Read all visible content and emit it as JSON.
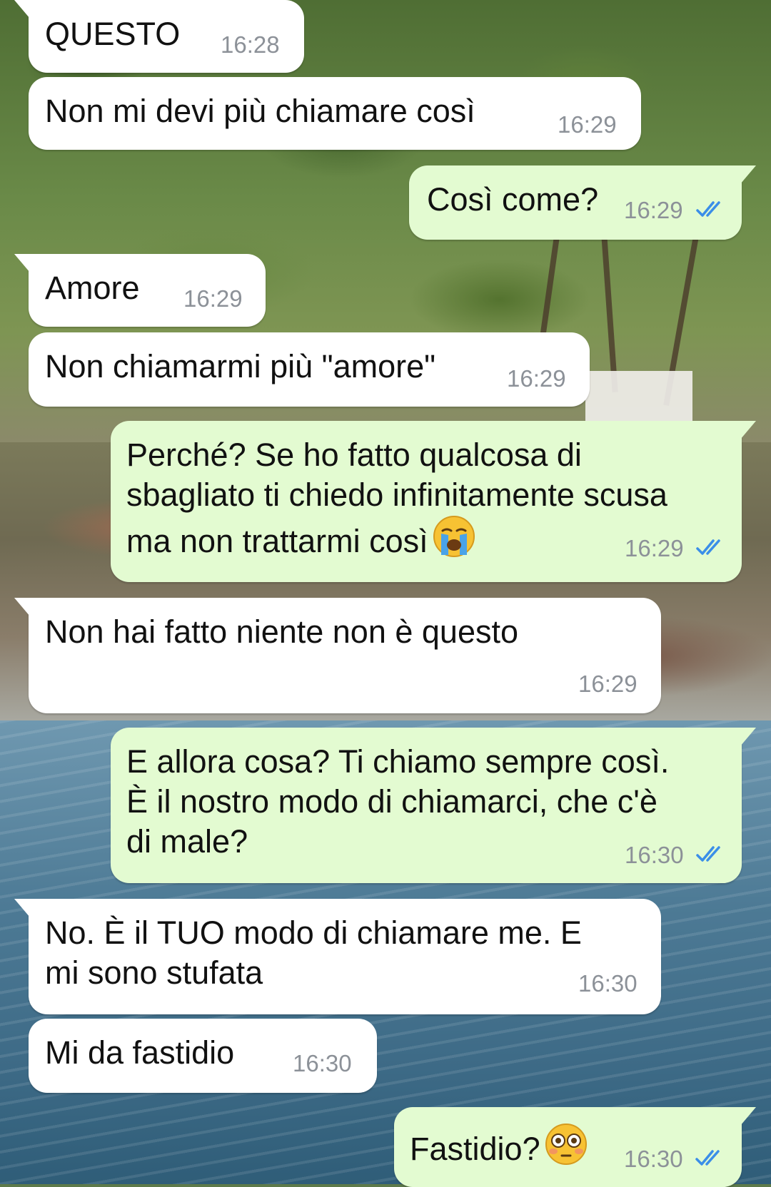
{
  "theme": {
    "incoming_bubble": "#ffffff",
    "outgoing_bubble": "#e3fbd1",
    "read_ticks": "#3b8ee8",
    "timestamp": "#8c9198"
  },
  "messages": [
    {
      "direction": "incoming",
      "lines": [
        "QUESTO"
      ],
      "time": "16:28"
    },
    {
      "direction": "incoming",
      "lines": [
        "Non mi devi più chiamare così"
      ],
      "time": "16:29"
    },
    {
      "direction": "outgoing",
      "lines": [
        "Così come?"
      ],
      "time": "16:29",
      "status": "read"
    },
    {
      "direction": "incoming",
      "lines": [
        "Amore"
      ],
      "time": "16:29"
    },
    {
      "direction": "incoming",
      "lines": [
        "Non chiamarmi più \"amore\""
      ],
      "time": "16:29"
    },
    {
      "direction": "outgoing",
      "lines": [
        "Perché? Se ho fatto qualcosa di",
        "sbagliato ti chiedo infinitamente scusa",
        "ma non trattarmi così"
      ],
      "emoji": "crying-face",
      "time": "16:29",
      "status": "read"
    },
    {
      "direction": "incoming",
      "lines": [
        "Non hai fatto niente non è questo"
      ],
      "time": "16:29"
    },
    {
      "direction": "outgoing",
      "lines": [
        "E allora cosa? Ti chiamo sempre così.",
        "È il nostro modo di chiamarci, che c'è",
        "di male?"
      ],
      "time": "16:30",
      "status": "read"
    },
    {
      "direction": "incoming",
      "lines": [
        "No. È il TUO modo di chiamare me. E",
        "mi sono stufata"
      ],
      "time": "16:30"
    },
    {
      "direction": "incoming",
      "lines": [
        "Mi da fastidio"
      ],
      "time": "16:30"
    },
    {
      "direction": "outgoing",
      "lines": [
        "Fastidio?"
      ],
      "emoji": "flushed-face",
      "time": "16:30",
      "status": "read"
    }
  ]
}
